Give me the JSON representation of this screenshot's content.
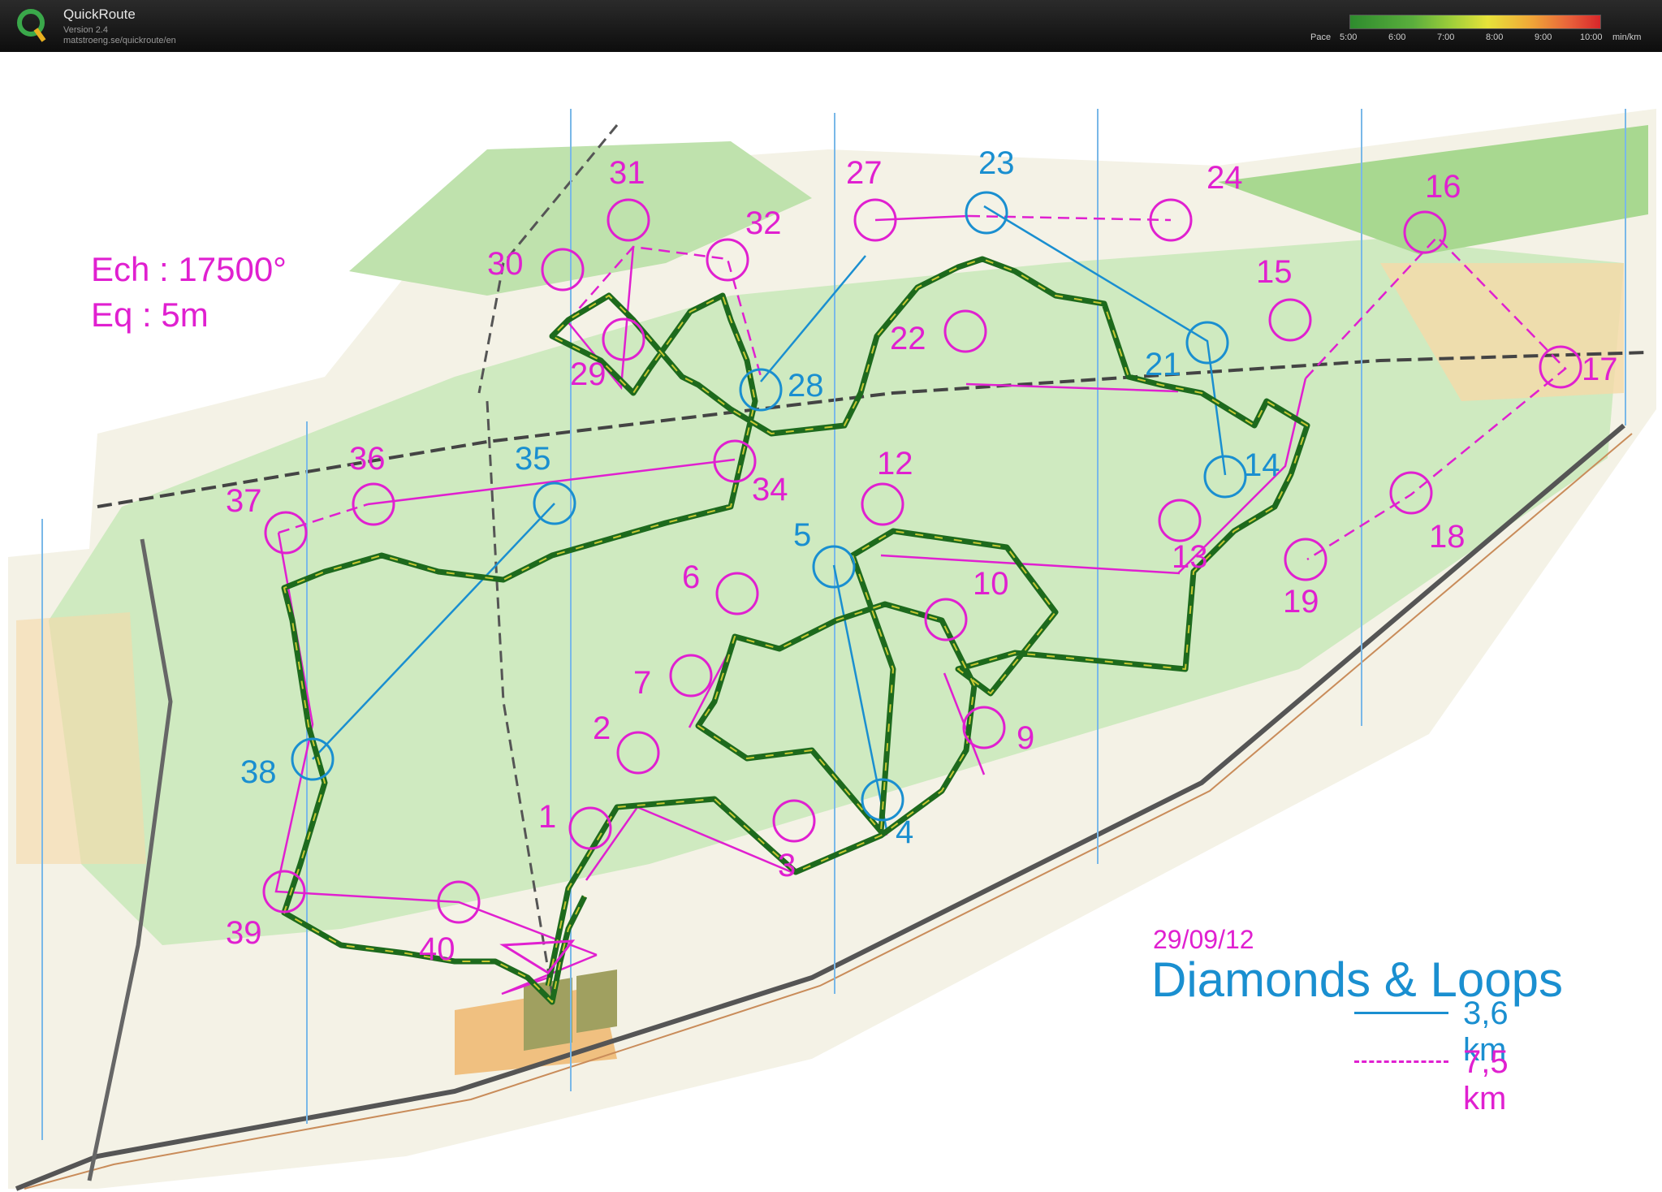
{
  "app": {
    "name": "QuickRoute",
    "version": "Version 2.4",
    "url": "matstroeng.se/quickroute/en"
  },
  "pace_legend": {
    "label": "Pace",
    "ticks": [
      "5:00",
      "6:00",
      "7:00",
      "8:00",
      "9:00",
      "10:00"
    ],
    "unit": "min/km",
    "gradient_colors": [
      "#2e8b2e",
      "#9ccd3a",
      "#e7e33a",
      "#f0a838",
      "#d8262a"
    ]
  },
  "map": {
    "scale": "Ech : 17500°",
    "equidistance": "Eq : 5m",
    "date": "29/09/12",
    "title": "Diamonds & Loops",
    "legend": [
      {
        "length": "3,6 km",
        "color": "#1a8fd0",
        "style": "solid"
      },
      {
        "length": "7,5 km",
        "color": "#e020d0",
        "style": "dashed"
      }
    ],
    "colors": {
      "short_course": "#1a8fd0",
      "long_course": "#e020d0",
      "forest": "#c8e8b8",
      "open_land": "#f6d7a0",
      "track_route": "#2f7a2a"
    },
    "controls": [
      {
        "n": "1",
        "course": "long"
      },
      {
        "n": "2",
        "course": "long"
      },
      {
        "n": "3",
        "course": "long"
      },
      {
        "n": "4",
        "course": "short"
      },
      {
        "n": "5",
        "course": "short"
      },
      {
        "n": "6",
        "course": "long"
      },
      {
        "n": "7",
        "course": "long"
      },
      {
        "n": "9",
        "course": "long"
      },
      {
        "n": "10",
        "course": "long"
      },
      {
        "n": "12",
        "course": "long"
      },
      {
        "n": "13",
        "course": "long"
      },
      {
        "n": "14",
        "course": "short"
      },
      {
        "n": "15",
        "course": "long"
      },
      {
        "n": "16",
        "course": "long"
      },
      {
        "n": "17",
        "course": "long"
      },
      {
        "n": "18",
        "course": "long"
      },
      {
        "n": "19",
        "course": "long"
      },
      {
        "n": "21",
        "course": "short"
      },
      {
        "n": "22",
        "course": "long"
      },
      {
        "n": "23",
        "course": "short"
      },
      {
        "n": "24",
        "course": "long"
      },
      {
        "n": "27",
        "course": "long"
      },
      {
        "n": "28",
        "course": "short"
      },
      {
        "n": "29",
        "course": "long"
      },
      {
        "n": "30",
        "course": "long"
      },
      {
        "n": "31",
        "course": "long"
      },
      {
        "n": "32",
        "course": "long"
      },
      {
        "n": "34",
        "course": "long"
      },
      {
        "n": "35",
        "course": "short"
      },
      {
        "n": "36",
        "course": "long"
      },
      {
        "n": "37",
        "course": "long"
      },
      {
        "n": "38",
        "course": "short"
      },
      {
        "n": "39",
        "course": "long"
      },
      {
        "n": "40",
        "course": "long"
      }
    ]
  }
}
